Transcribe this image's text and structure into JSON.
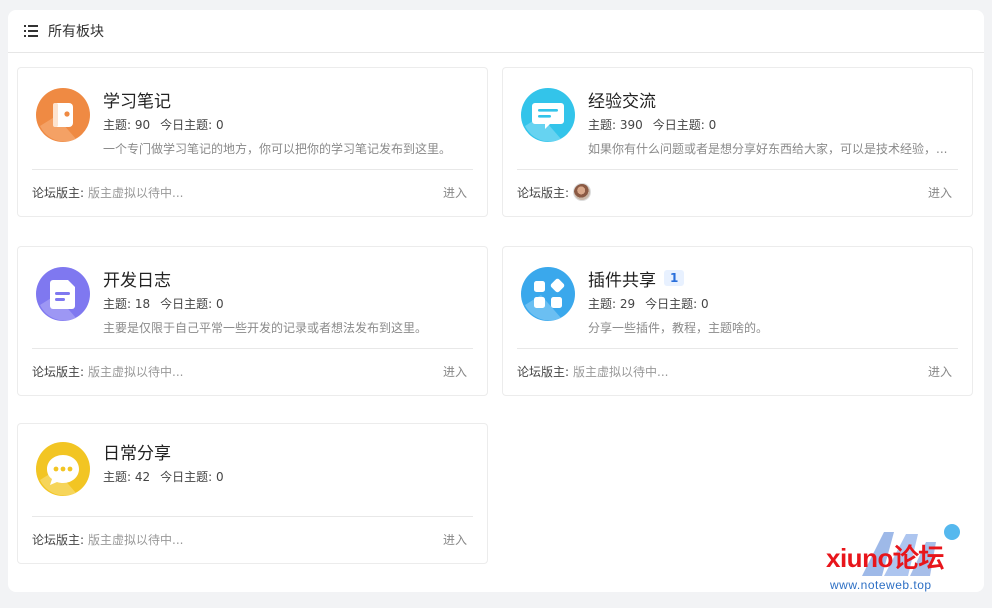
{
  "header": {
    "title": "所有板块",
    "icon": "list-icon"
  },
  "boards": [
    {
      "name": "学习笔记",
      "icon": "notebook-icon",
      "icon_color": "#ef8a43",
      "topics_label": "主题:",
      "topics": "90",
      "today_label": "今日主题:",
      "today": "0",
      "description": "一个专门做学习笔记的地方，你可以把你的学习笔记发布到这里。",
      "moderator_label": "论坛版主:",
      "moderator": "版主虚拟以待中...",
      "enter_label": "进入"
    },
    {
      "name": "经验交流",
      "icon": "chat-bubble-icon",
      "icon_color": "#33c4ea",
      "topics_label": "主题:",
      "topics": "390",
      "today_label": "今日主题:",
      "today": "0",
      "description": "如果你有什么问题或者是想分享好东西给大家，可以是技术经验，...",
      "moderator_label": "论坛版主:",
      "moderator": "",
      "enter_label": "进入"
    },
    {
      "name": "开发日志",
      "icon": "document-icon",
      "icon_color": "#7f78f0",
      "topics_label": "主题:",
      "topics": "18",
      "today_label": "今日主题:",
      "today": "0",
      "description": "主要是仅限于自己平常一些开发的记录或者想法发布到这里。",
      "moderator_label": "论坛版主:",
      "moderator": "版主虚拟以待中...",
      "enter_label": "进入"
    },
    {
      "name": "插件共享",
      "badge": "1",
      "icon": "apps-icon",
      "icon_color": "#3aa8ec",
      "topics_label": "主题:",
      "topics": "29",
      "today_label": "今日主题:",
      "today": "0",
      "description": "分享一些插件，教程，主题啥的。",
      "moderator_label": "论坛版主:",
      "moderator": "版主虚拟以待中...",
      "enter_label": "进入"
    },
    {
      "name": "日常分享",
      "icon": "message-dots-icon",
      "icon_color": "#f2c523",
      "topics_label": "主题:",
      "topics": "42",
      "today_label": "今日主题:",
      "today": "0",
      "description": "",
      "moderator_label": "论坛版主:",
      "moderator": "版主虚拟以待中...",
      "enter_label": "进入"
    }
  ],
  "watermark": {
    "text": "xiuno论坛",
    "url": "www.noteweb.top"
  }
}
